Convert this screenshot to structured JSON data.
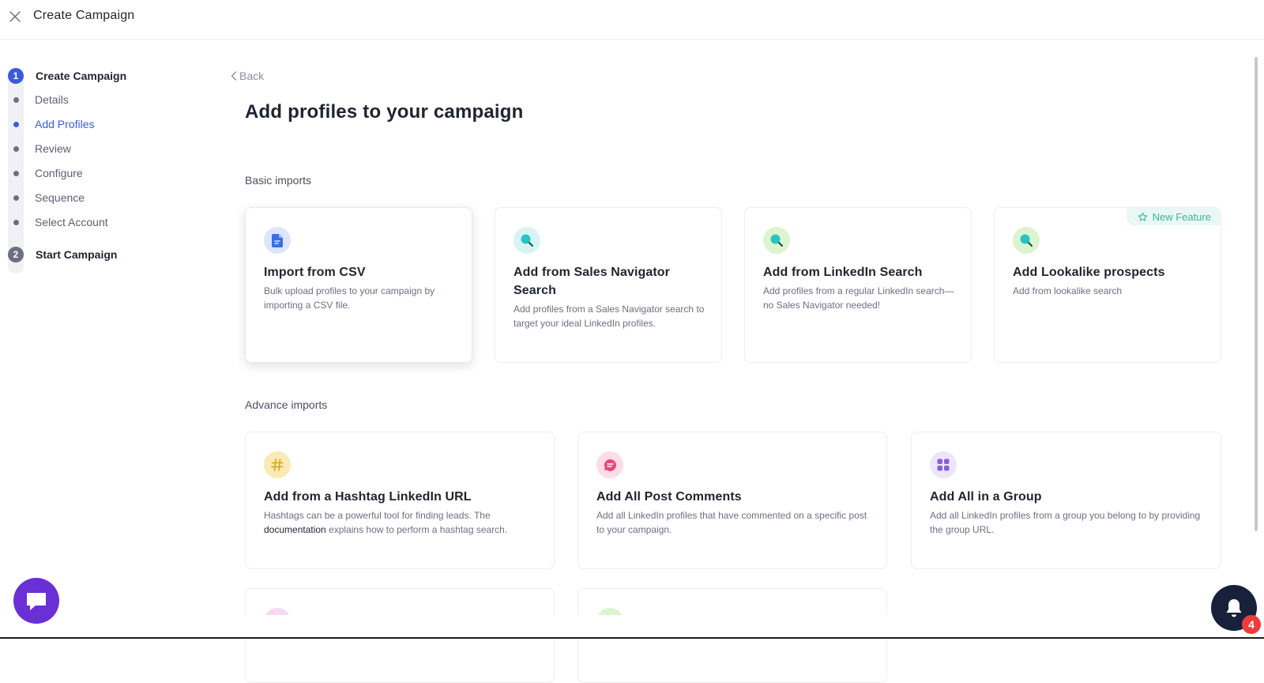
{
  "header": {
    "title": "Create Campaign"
  },
  "steps": {
    "step1": {
      "number": "1",
      "label": "Create Campaign"
    },
    "substeps": [
      "Details",
      "Add Profiles",
      "Review",
      "Configure",
      "Sequence",
      "Select Account"
    ],
    "active_substep": "Add Profiles",
    "step2": {
      "number": "2",
      "label": "Start Campaign"
    }
  },
  "nav": {
    "back_label": "Back"
  },
  "page": {
    "title": "Add profiles to your campaign"
  },
  "basic": {
    "label": "Basic imports",
    "cards": [
      {
        "title": "Import from CSV",
        "desc": "Bulk upload profiles to your campaign by importing a CSV file."
      },
      {
        "title": "Add from Sales Navigator Search",
        "desc": "Add profiles from a Sales Navigator search to target your ideal LinkedIn profiles."
      },
      {
        "title": "Add from LinkedIn Search",
        "desc": "Add profiles from a regular LinkedIn search—no Sales Navigator needed!"
      },
      {
        "title": "Add Lookalike prospects",
        "desc": "Add from lookalike search",
        "badge": "New Feature"
      }
    ]
  },
  "advance": {
    "label": "Advance imports",
    "cards": [
      {
        "title": "Add from a Hashtag LinkedIn URL",
        "desc_before": "Hashtags can be a powerful tool for finding leads. The ",
        "desc_link": "documentation",
        "desc_after": " explains how to perform a hashtag search."
      },
      {
        "title": "Add All Post Comments",
        "desc": "Add all LinkedIn profiles that have commented on a specific post to your campaign."
      },
      {
        "title": "Add All in a Group",
        "desc": "Add all LinkedIn profiles from a group you belong to by providing the group URL."
      }
    ]
  },
  "notifications": {
    "count": "4"
  },
  "colors": {
    "accent": "#3b5bdb",
    "chat": "#6b2fd6",
    "bell": "#17213a",
    "badge_text": "#3cb59a"
  }
}
